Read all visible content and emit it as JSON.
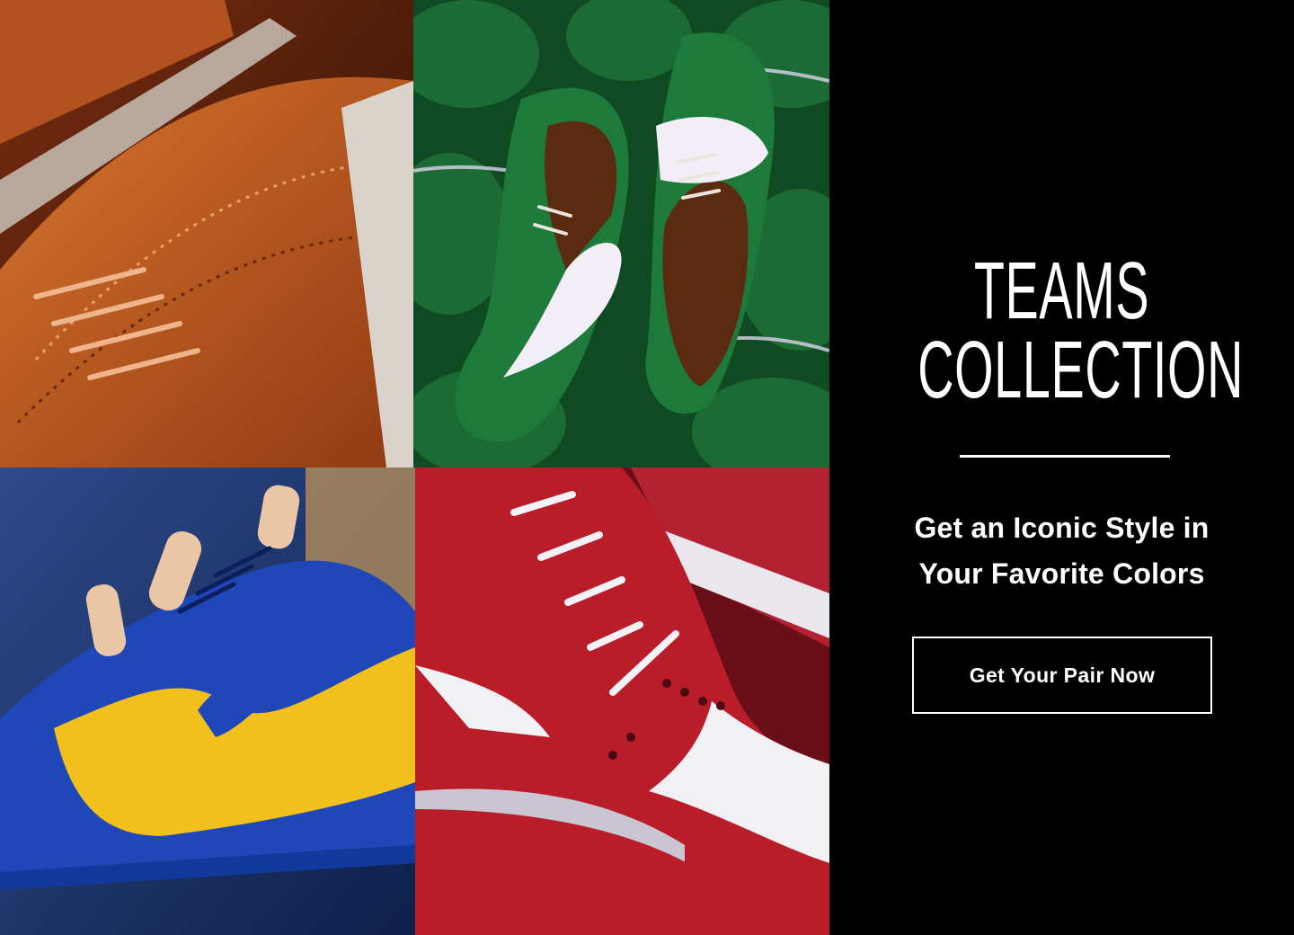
{
  "promo": {
    "title_line1": "TEAMS",
    "title_line2": "COLLECTION",
    "subtitle_line1": "Get an Iconic Style in",
    "subtitle_line2": "Your Favorite Colors",
    "cta_label": "Get Your Pair Now"
  },
  "tiles": [
    {
      "name": "tan-brogue-shoes-photo",
      "colors": [
        "#b5551f",
        "#3a1608"
      ]
    },
    {
      "name": "green-white-brogues-photo",
      "colors": [
        "#1f7a3c",
        "#f1eef4"
      ]
    },
    {
      "name": "blue-yellow-brogue-photo",
      "colors": [
        "#1f47b8",
        "#f2c01d"
      ]
    },
    {
      "name": "red-white-brogue-photo",
      "colors": [
        "#b91d2a",
        "#f1f1f4"
      ]
    }
  ]
}
